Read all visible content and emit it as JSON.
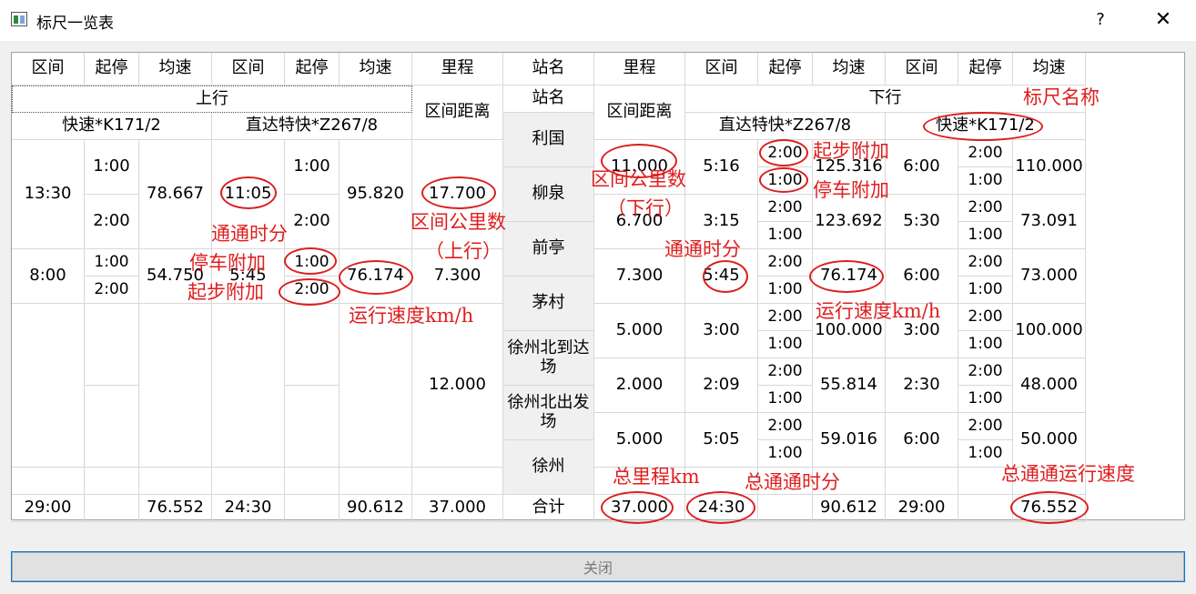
{
  "window": {
    "title": "标尺一览表",
    "help": "?",
    "close": "✕"
  },
  "header": {
    "cols": [
      "区间",
      "起停",
      "均速",
      "区间",
      "起停",
      "均速",
      "里程",
      "站名",
      "里程",
      "区间",
      "起停",
      "均速",
      "区间",
      "起停",
      "均速"
    ]
  },
  "up": {
    "group": "上行",
    "train_left": "快速*K171/2",
    "train_right": "直达特快*Z267/8",
    "dist_label": "区间距离"
  },
  "station_label": "站名",
  "down": {
    "group": "下行",
    "dist_label": "区间距离",
    "train_left": "直达特快*Z267/8",
    "train_right": "快速*K171/2"
  },
  "stations": [
    "利国",
    "柳泉",
    "前亭",
    "茅村",
    "徐州北到达场",
    "徐州北出发场",
    "徐州"
  ],
  "up_rows": [
    {
      "k_time": "13:30",
      "k_stop_a": "1:00",
      "k_stop_b": "2:00",
      "k_speed": "78.667",
      "z_time": "11:05",
      "z_stop_a": "1:00",
      "z_stop_b": "2:00",
      "z_speed": "95.820",
      "dist": "17.700"
    },
    {
      "k_time": "8:00",
      "k_stop_a": "1:00",
      "k_stop_b": "2:00",
      "k_speed": "54.750",
      "z_time": "5:45",
      "z_stop_a": "1:00",
      "z_stop_b": "2:00",
      "z_speed": "76.174",
      "dist": "7.300"
    }
  ],
  "up_dist_merged": "12.000",
  "down_rows": [
    {
      "dist": "11.000",
      "z_time": "5:16",
      "z_start": "2:00",
      "z_stop": "1:00",
      "z_speed": "125.316",
      "k_time": "6:00",
      "k_start": "2:00",
      "k_stop": "1:00",
      "k_speed": "110.000"
    },
    {
      "dist": "6.700",
      "z_time": "3:15",
      "z_start": "2:00",
      "z_stop": "1:00",
      "z_speed": "123.692",
      "k_time": "5:30",
      "k_start": "2:00",
      "k_stop": "1:00",
      "k_speed": "73.091"
    },
    {
      "dist": "7.300",
      "z_time": "5:45",
      "z_start": "2:00",
      "z_stop": "1:00",
      "z_speed": "76.174",
      "k_time": "6:00",
      "k_start": "2:00",
      "k_stop": "1:00",
      "k_speed": "73.000"
    },
    {
      "dist": "5.000",
      "z_time": "3:00",
      "z_start": "2:00",
      "z_stop": "1:00",
      "z_speed": "100.000",
      "k_time": "3:00",
      "k_start": "2:00",
      "k_stop": "1:00",
      "k_speed": "100.000"
    },
    {
      "dist": "2.000",
      "z_time": "2:09",
      "z_start": "2:00",
      "z_stop": "1:00",
      "z_speed": "55.814",
      "k_time": "2:30",
      "k_start": "2:00",
      "k_stop": "1:00",
      "k_speed": "48.000"
    },
    {
      "dist": "5.000",
      "z_time": "5:05",
      "z_start": "2:00",
      "z_stop": "1:00",
      "z_speed": "59.016",
      "k_time": "6:00",
      "k_start": "2:00",
      "k_stop": "1:00",
      "k_speed": "50.000"
    }
  ],
  "totals": [
    "29:00",
    "",
    "76.552",
    "24:30",
    "",
    "90.612",
    "37.000",
    "合计",
    "37.000",
    "24:30",
    "",
    "90.612",
    "29:00",
    "",
    "76.552"
  ],
  "annotations": {
    "ruler_name": "标尺名称",
    "start_add_1": "起步附加",
    "stop_add_1": "停车附加",
    "dist_down": "区间公里数",
    "dist_down_2": "（下行）",
    "dist_up": "区间公里数",
    "dist_up_2": "（上行）",
    "pass_time_up": "通通时分",
    "stop_add_up": "停车附加",
    "start_add_up": "起步附加",
    "speed_up": "运行速度km/h",
    "pass_time_down": "通通时分",
    "speed_down": "运行速度km/h",
    "total_dist": "总里程km",
    "total_time": "总通通时分",
    "total_speed": "总通通运行速度"
  },
  "close_button": "关闭"
}
